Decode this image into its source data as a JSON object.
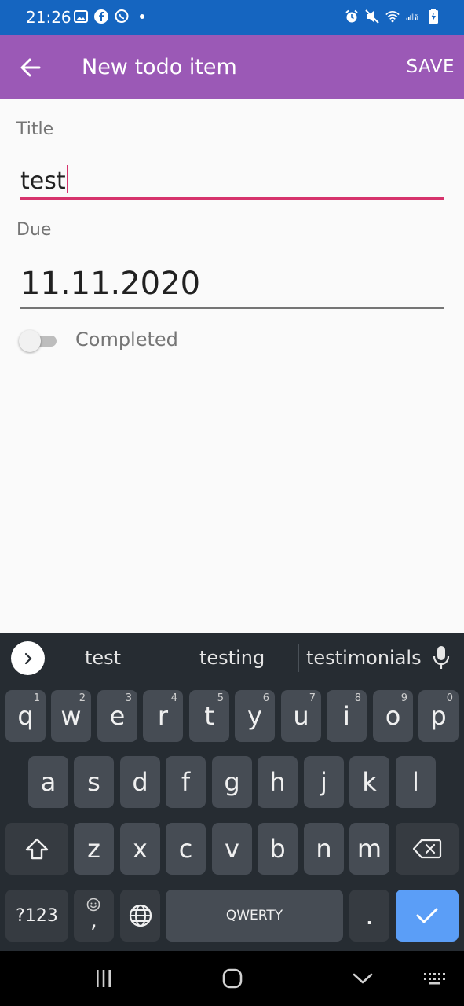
{
  "status_bar": {
    "time": "21:26",
    "left_icons": [
      "gallery-icon",
      "facebook-icon",
      "viber-icon",
      "dot-icon"
    ],
    "right_icons": [
      "alarm-icon",
      "mute-icon",
      "wifi-icon",
      "signal-icon",
      "battery-charging-icon"
    ]
  },
  "app_bar": {
    "title": "New todo item",
    "save_label": "SAVE",
    "color": "#9b59b6"
  },
  "form": {
    "title_label": "Title",
    "title_value": "test",
    "due_label": "Due",
    "due_value": "11.11.2020",
    "completed_label": "Completed",
    "completed": false
  },
  "keyboard": {
    "suggestions": [
      "test",
      "testing",
      "testimonials"
    ],
    "row1": [
      {
        "key": "q",
        "hint": "1"
      },
      {
        "key": "w",
        "hint": "2"
      },
      {
        "key": "e",
        "hint": "3"
      },
      {
        "key": "r",
        "hint": "4"
      },
      {
        "key": "t",
        "hint": "5"
      },
      {
        "key": "y",
        "hint": "6"
      },
      {
        "key": "u",
        "hint": "7"
      },
      {
        "key": "i",
        "hint": "8"
      },
      {
        "key": "o",
        "hint": "9"
      },
      {
        "key": "p",
        "hint": "0"
      }
    ],
    "row2": [
      "a",
      "s",
      "d",
      "f",
      "g",
      "h",
      "j",
      "k",
      "l"
    ],
    "row3": [
      "z",
      "x",
      "c",
      "v",
      "b",
      "n",
      "m"
    ],
    "symbols_label": "?123",
    "comma_label": ",",
    "space_label": "QWERTY",
    "period_label": "."
  }
}
